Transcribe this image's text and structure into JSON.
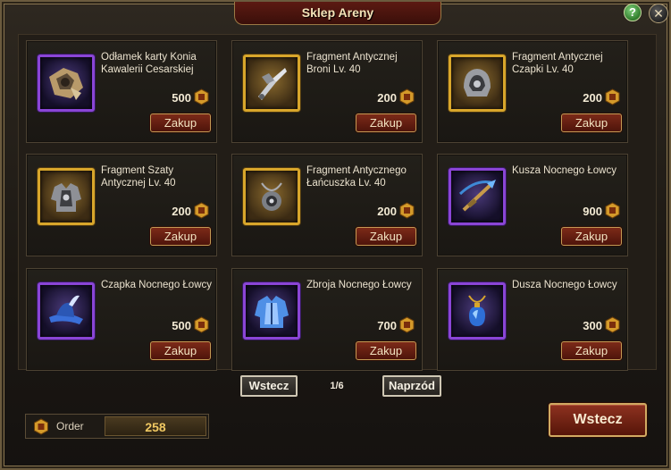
{
  "window": {
    "title": "Sklep Areny",
    "help_label": "?",
    "close_label": "✕"
  },
  "items": [
    {
      "name": "Odłamek karty Konia Kawalerii Cesarskiej",
      "price": "500",
      "buy_label": "Zakup",
      "rarity": "epic",
      "icon": "horse-card-shard-icon"
    },
    {
      "name": "Fragment Antycznej Broni Lv. 40",
      "price": "200",
      "buy_label": "Zakup",
      "rarity": "legendary",
      "icon": "ancient-weapon-fragment-icon"
    },
    {
      "name": "Fragment Antycznej Czapki Lv. 40",
      "price": "200",
      "buy_label": "Zakup",
      "rarity": "legendary",
      "icon": "ancient-helmet-fragment-icon"
    },
    {
      "name": "Fragment Szaty Antycznej Lv. 40",
      "price": "200",
      "buy_label": "Zakup",
      "rarity": "legendary",
      "icon": "ancient-robe-fragment-icon"
    },
    {
      "name": "Fragment Antycznego Łańcuszka Lv. 40",
      "price": "200",
      "buy_label": "Zakup",
      "rarity": "legendary",
      "icon": "ancient-necklace-fragment-icon"
    },
    {
      "name": "Kusza Nocnego Łowcy",
      "price": "900",
      "buy_label": "Zakup",
      "rarity": "epic",
      "icon": "crossbow-icon"
    },
    {
      "name": "Czapka Nocnego Łowcy",
      "price": "500",
      "buy_label": "Zakup",
      "rarity": "epic",
      "icon": "hat-icon"
    },
    {
      "name": "Zbroja Nocnego Łowcy",
      "price": "700",
      "buy_label": "Zakup",
      "rarity": "epic",
      "icon": "armor-icon"
    },
    {
      "name": "Dusza Nocnego Łowcy",
      "price": "300",
      "buy_label": "Zakup",
      "rarity": "epic",
      "icon": "amulet-icon"
    }
  ],
  "pager": {
    "prev_label": "Wstecz",
    "page": "1/6",
    "next_label": "Naprzód"
  },
  "currency": {
    "label": "Order",
    "value": "258",
    "icon": "order-coin-icon"
  },
  "footer": {
    "back_label": "Wstecz"
  },
  "colors": {
    "legendary_border": "#d8a62b",
    "epic_border": "#8a45d6",
    "button_red": "#7c2a18",
    "title_red": "#5c1a12",
    "gold_text": "#f0c862"
  }
}
